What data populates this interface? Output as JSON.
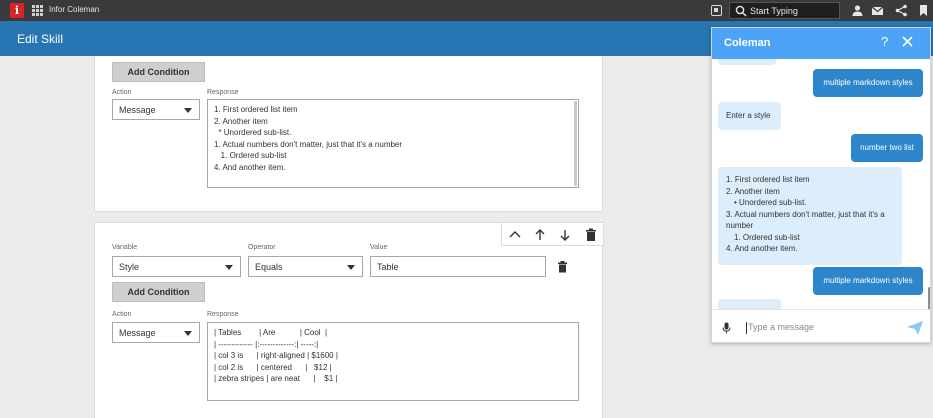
{
  "topbar": {
    "app_name": "Infor Coleman",
    "search_placeholder": "Start Typing"
  },
  "header": {
    "title": "Edit Skill"
  },
  "card1": {
    "add_condition": "Add Condition",
    "action_label": "Action",
    "action_value": "Message",
    "response_label": "Response",
    "response_lines": [
      "1. First ordered list item",
      "2. Another item",
      "  * Unordered sub-list.",
      "1. Actual numbers don't matter, just that it's a number",
      "   1. Ordered sub-list",
      "4. And another item."
    ]
  },
  "card2": {
    "variable_label": "Variable",
    "variable_value": "Style",
    "operator_label": "Operator",
    "operator_value": "Equals",
    "value_label": "Value",
    "value_value": "Table",
    "add_condition": "Add Condition",
    "action_label": "Action",
    "action_value": "Message",
    "response_label": "Response",
    "response_lines": [
      "| Tables        | Are           | Cool  |",
      "| ------------- |:-------------:| -----:|",
      "| col 3 is      | right-aligned | $1600 |",
      "| col 2 is      | centered      |   $12 |",
      "| zebra stripes | are neat      |    $1 |"
    ]
  },
  "chat": {
    "title": "Coleman",
    "help": "?",
    "user_msg_1": "multiple markdown styles",
    "bot_msg_1": "Enter a style",
    "user_msg_2": "number two list",
    "bot_list": {
      "item1": "First ordered list item",
      "item2": "Another item",
      "sub1": "Unordered sub-list.",
      "item3": "Actual numbers don't matter, just that it's a number",
      "sub2": "Ordered sub-list",
      "item4": "And another item."
    },
    "user_msg_3": "multiple markdown styles",
    "input_placeholder": "Type a message"
  },
  "colors": {
    "header": "#2776b3",
    "chat_header": "#4da3f5",
    "user_bubble": "#2d86cc",
    "bot_bubble": "#dcedfb",
    "logo": "#d8232a"
  }
}
